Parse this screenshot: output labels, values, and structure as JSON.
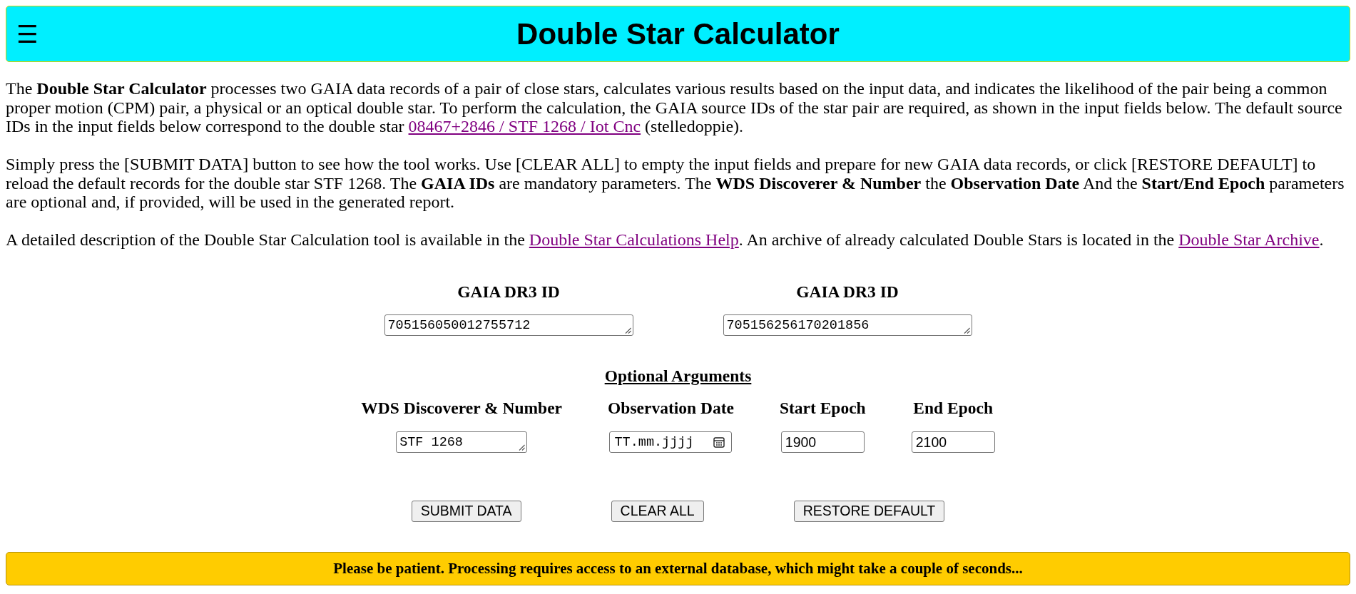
{
  "header": {
    "menu_button": "☰",
    "title": "Double Star Calculator"
  },
  "intro": [
    {
      "parts": [
        {
          "kind": "text",
          "text": "The **Double Star Calculator** processes two GAIA data records of a pair of close stars, calculates various results based on the input data, and indicates the likelihood of the pair being a common proper motion (CPM) pair, a physical or an optical double star. To perform the calculation, the GAIA source IDs of the star pair are required, as shown in the input fields below. The default source IDs in the input fields below correspond to the double star "
        },
        {
          "kind": "link",
          "text": "08467+2846 / STF 1268 / Iot Cnc"
        },
        {
          "kind": "text",
          "text": " (stelledoppie)."
        }
      ]
    },
    {
      "parts": [
        {
          "kind": "text",
          "text": "Simply press the [SUBMIT DATA] button to see how the tool works. Use [CLEAR ALL] to empty the input fields and prepare for new GAIA data records, or click [RESTORE DEFAULT] to reload the default records for the double star STF 1268. The **GAIA IDs** are mandatory parameters. The **WDS Discoverer & Number** the **Observation Date** And the **Start/End Epoch** parameters are optional and, if provided, will be used in the generated report."
        }
      ]
    },
    {
      "parts": [
        {
          "kind": "text",
          "text": "A detailed description of the Double Star Calculation tool is available in the "
        },
        {
          "kind": "link",
          "text": "Double Star Calculations Help"
        },
        {
          "kind": "text",
          "text": ". An archive of already calculated Double Stars is located in the "
        },
        {
          "kind": "link",
          "text": "Double Star Archive"
        },
        {
          "kind": "text",
          "text": "."
        }
      ]
    }
  ],
  "gaia_ids": [
    {
      "label": "GAIA DR3 ID",
      "value": "705156050012755712"
    },
    {
      "label": "GAIA DR3 ID",
      "value": "705156256170201856"
    }
  ],
  "optional_arguments": {
    "title": "Optional Arguments",
    "fields": [
      {
        "kind": "textarea",
        "label": "WDS Discoverer & Number",
        "value": "STF 1268"
      },
      {
        "kind": "date",
        "label": "Observation Date",
        "placeholder": "TT.mm.jjjj"
      },
      {
        "kind": "number",
        "label": "Start Epoch",
        "value": "1900"
      },
      {
        "kind": "number",
        "label": "End Epoch",
        "value": "2100"
      }
    ]
  },
  "buttons": [
    "SUBMIT DATA",
    "CLEAR ALL",
    "RESTORE DEFAULT"
  ],
  "notice": "Please be patient. Processing requires access to an external database, which might take a couple of seconds..."
}
